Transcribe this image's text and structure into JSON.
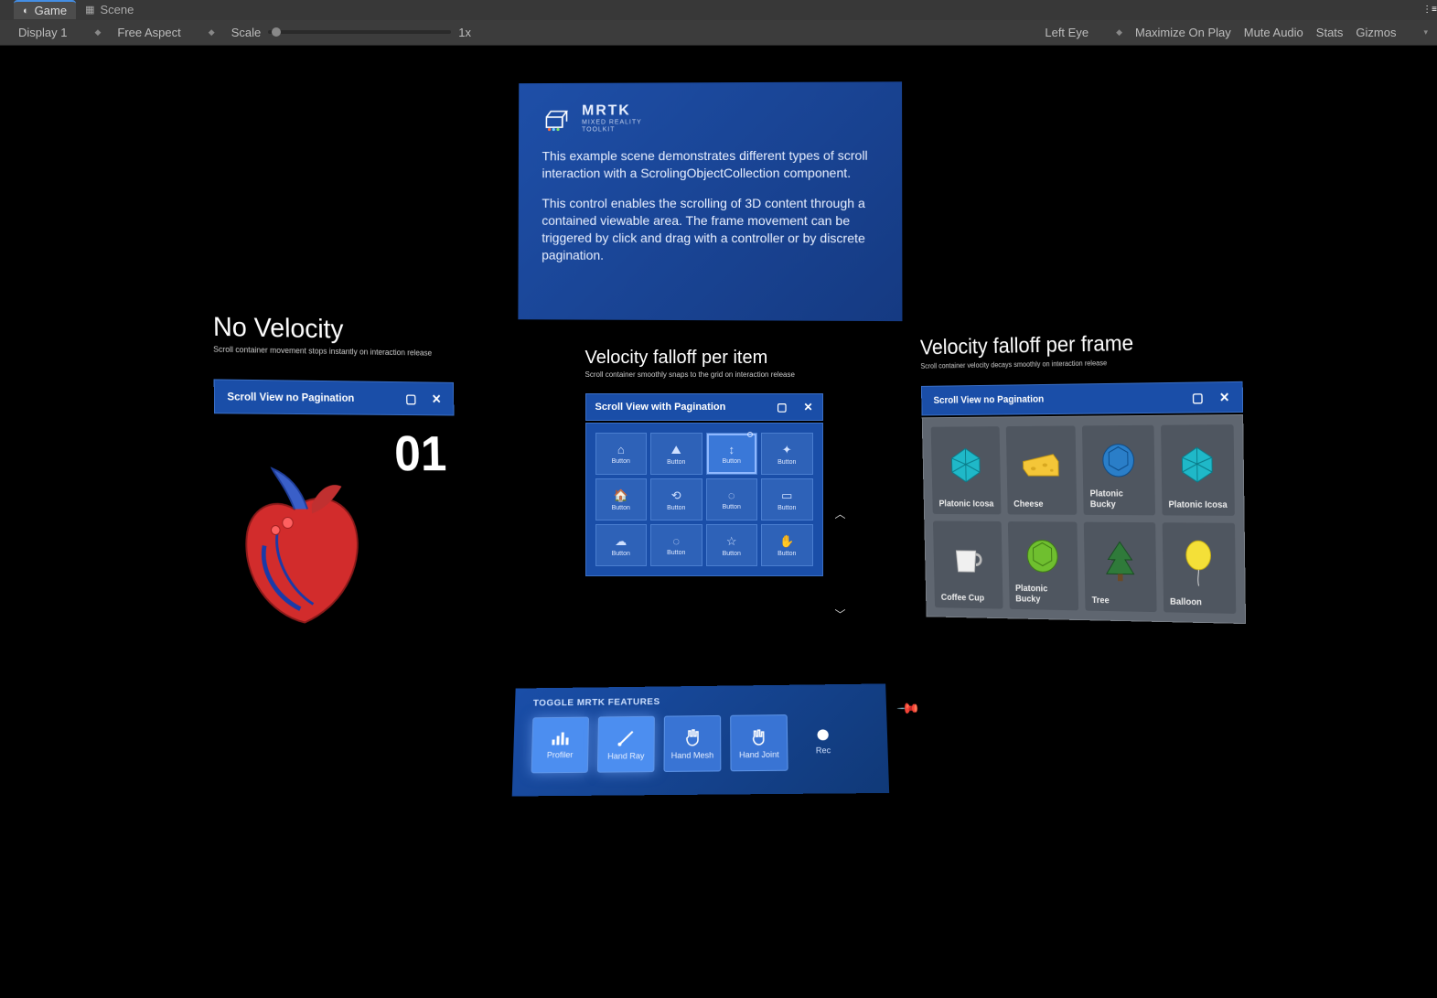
{
  "tabs": {
    "game": "Game",
    "scene": "Scene"
  },
  "toolbar": {
    "display": "Display 1",
    "aspect": "Free Aspect",
    "scale_label": "Scale",
    "scale_value": "1x",
    "eye": "Left Eye",
    "maximize": "Maximize On Play",
    "mute": "Mute Audio",
    "stats": "Stats",
    "gizmos": "Gizmos"
  },
  "info": {
    "brand": "MRTK",
    "brand_sub": "MIXED REALITY\nTOOLKIT",
    "p1": "This example scene demonstrates different types of scroll interaction with a ScrolingObjectCollection component.",
    "p2": "This control enables the scrolling of 3D content through a contained viewable area. The frame movement can be triggered by click and drag with a controller or by discrete pagination."
  },
  "left": {
    "title": "No Velocity",
    "sub": "Scroll container movement stops instantly on interaction release",
    "header": "Scroll View no Pagination",
    "number": "01"
  },
  "center": {
    "title": "Velocity falloff per item",
    "sub": "Scroll container smoothly snaps to the grid on interaction release",
    "header": "Scroll View with Pagination",
    "btn_label": "Button",
    "buttons": [
      {
        "icon": "⌂"
      },
      {
        "icon": "⛰"
      },
      {
        "icon": "↕",
        "focus": true
      },
      {
        "icon": "✦"
      },
      {
        "icon": "🏠"
      },
      {
        "icon": "⟲"
      },
      {
        "icon": "◌"
      },
      {
        "icon": "▭"
      },
      {
        "icon": "☁"
      },
      {
        "icon": "◌"
      },
      {
        "icon": "☆"
      },
      {
        "icon": "✋"
      }
    ]
  },
  "right": {
    "title": "Velocity falloff per frame",
    "sub": "Scroll container velocity decays smoothly on interaction release",
    "header": "Scroll View no Pagination",
    "cards": [
      {
        "label": "Platonic Icosa",
        "kind": "icosa-teal"
      },
      {
        "label": "Cheese",
        "kind": "cheese"
      },
      {
        "label": "Platonic Bucky",
        "kind": "bucky-blue"
      },
      {
        "label": "Platonic Icosa",
        "kind": "icosa-teal"
      },
      {
        "label": "Coffee Cup",
        "kind": "cup"
      },
      {
        "label": "Platonic Bucky",
        "kind": "bucky-green"
      },
      {
        "label": "Tree",
        "kind": "tree"
      },
      {
        "label": "Balloon",
        "kind": "balloon"
      }
    ]
  },
  "bottom": {
    "title": "TOGGLE MRTK FEATURES",
    "buttons": [
      {
        "label": "Profiler",
        "icon": "bars",
        "lit": true
      },
      {
        "label": "Hand Ray",
        "icon": "ray",
        "lit": true
      },
      {
        "label": "Hand Mesh",
        "icon": "hand",
        "lit": false
      },
      {
        "label": "Hand Joint",
        "icon": "hand2",
        "lit": false
      }
    ],
    "rec": "Rec"
  },
  "icons": {
    "window": "▢",
    "close": "✕"
  }
}
